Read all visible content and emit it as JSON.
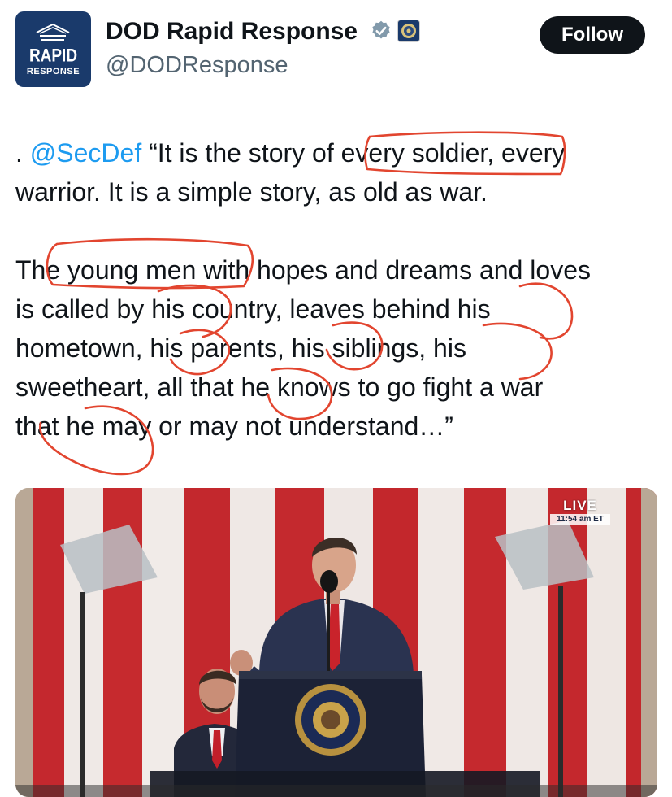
{
  "account": {
    "display_name": "DOD Rapid Response",
    "handle": "@DODResponse",
    "avatar_line1": "RAPID",
    "avatar_line2": "RESPONSE"
  },
  "follow_button": {
    "label": "Follow"
  },
  "tweet": {
    "mention_prefix": ". ",
    "mention": "@SecDef",
    "line1_rest": " “It is the story of every soldier, every",
    "line2": "warrior. It is a simple story, as old as war.",
    "line3": "The young men with hopes and dreams and loves",
    "line4": "is called by his country, leaves behind his",
    "line5": "hometown, his parents, his siblings, his",
    "line6": "sweetheart, all that he knows to go fight a war",
    "line7": "that he may or may not understand…”"
  },
  "media": {
    "live_label": "LIVE",
    "live_time": "11:54 am ET"
  },
  "colors": {
    "annotation_red": "#e2452f",
    "mention_blue": "#1d9bf0",
    "follow_bg": "#0f1419"
  }
}
